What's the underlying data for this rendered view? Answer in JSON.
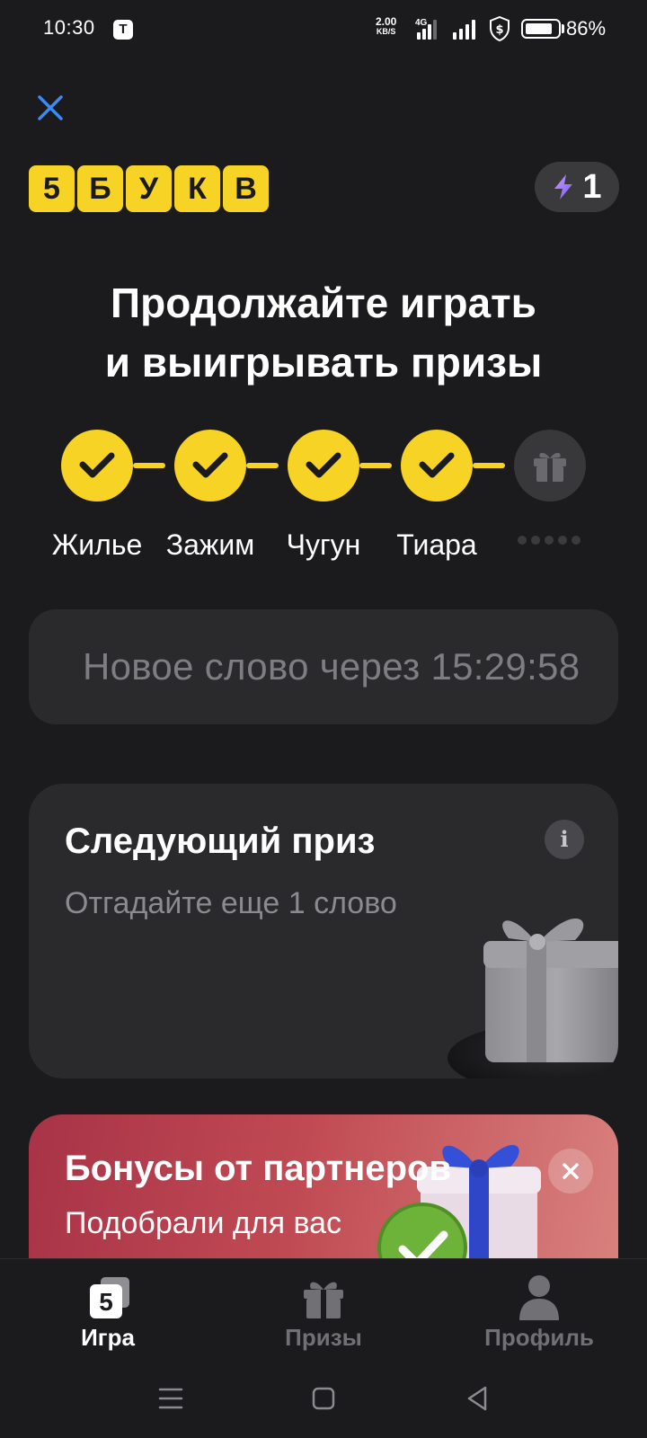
{
  "status_bar": {
    "time": "10:30",
    "app_badge": "T",
    "speed_value": "2.00",
    "speed_unit": "KB/S",
    "network": "4G",
    "battery": "86%",
    "battery_level": 0.86
  },
  "header": {
    "logo_letters": [
      "5",
      "Б",
      "У",
      "К",
      "В"
    ],
    "energy_count": "1"
  },
  "headline": {
    "line1": "Продолжайте играть",
    "line2": "и выигрывать призы"
  },
  "progress": {
    "steps": [
      {
        "label": "Жилье",
        "done": true
      },
      {
        "label": "Зажим",
        "done": true
      },
      {
        "label": "Чугун",
        "done": true
      },
      {
        "label": "Тиара",
        "done": true
      },
      {
        "label": "",
        "done": false
      }
    ]
  },
  "timer": {
    "text": "Новое слово через 15:29:58"
  },
  "next_prize": {
    "title": "Следующий приз",
    "subtitle": "Отгадайте еще 1 слово",
    "info_glyph": "i"
  },
  "bonus": {
    "title": "Бонусы от партнеров",
    "subtitle": "Подобрали для вас"
  },
  "bottom_nav": {
    "items": [
      {
        "label": "Игра",
        "active": true
      },
      {
        "label": "Призы",
        "active": false
      },
      {
        "label": "Профиль",
        "active": false
      }
    ],
    "game_icon_glyph": "5"
  },
  "colors": {
    "accent_yellow": "#f7d325",
    "background": "#1b1b1d",
    "card": "#2a2a2d",
    "close_blue": "#3d8af7",
    "bonus_red": "#b43a4c"
  }
}
